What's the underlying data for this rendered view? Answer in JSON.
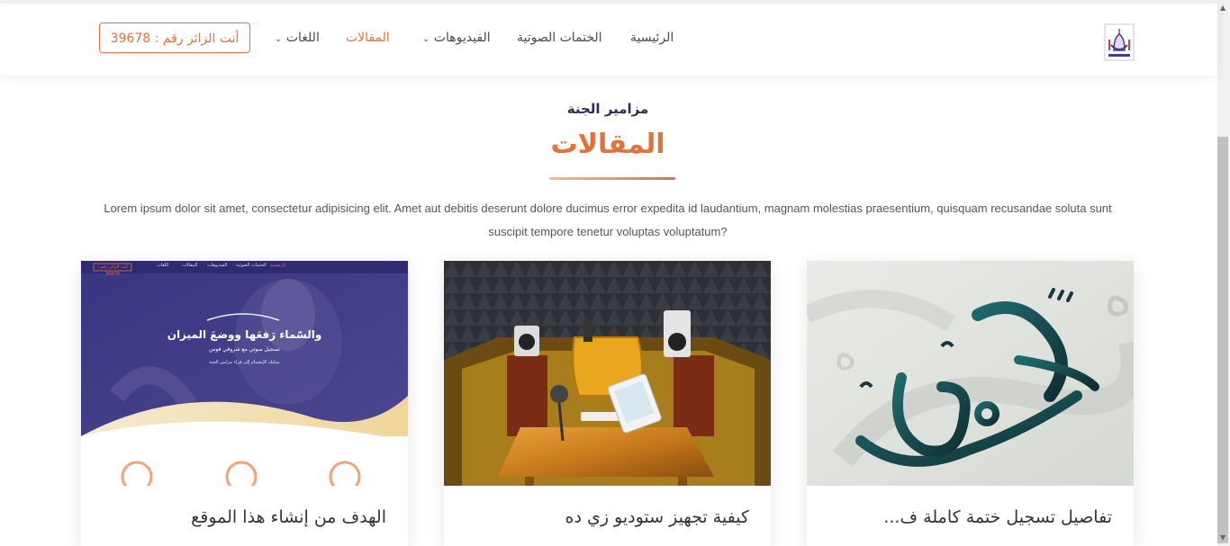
{
  "header": {
    "logo": "site-logo",
    "nav": [
      {
        "label": "الرئيسية",
        "active": false,
        "dropdown": false
      },
      {
        "label": "الختمات الصوتية",
        "active": false,
        "dropdown": false
      },
      {
        "label": "الفيديوهات",
        "active": false,
        "dropdown": true
      },
      {
        "label": "المقالات",
        "active": true,
        "dropdown": false
      },
      {
        "label": "اللغات",
        "active": false,
        "dropdown": true
      }
    ],
    "visitor_label": "أنت الزائر رقم : 39678"
  },
  "section": {
    "subtitle": "مزامير الجنة",
    "title": "المقالات",
    "description": "Lorem ipsum dolor sit amet, consectetur adipisicing elit. Amet aut debitis deserunt dolore ducimus error expedita id laudantium, magnam molestias praesentium, quisquam recusandae soluta sunt suscipit tempore tenetur voluptas voluptatum?"
  },
  "cards": [
    {
      "title": "تفاصيل تسجيل ختمة كاملة ف...",
      "image": "khatma-calligraphy"
    },
    {
      "title": "كيفية تجهيز ستوديو زي ده",
      "image": "recording-studio"
    },
    {
      "title": "الهدف من إنشاء هذا الموقع",
      "image": "website-screenshot",
      "thumb": {
        "verse": "والسّماء رَفعَها ووضعَ الميزان",
        "line1": "تسجيل صوتي مع شروقي فوس",
        "line2": "يمكنك الإنضمام إلى قراء مزامير الجنة",
        "nav": [
          "الرئيسية",
          "الختمات الصوتية",
          "الفيديوهات",
          "المقالات",
          "اللغات"
        ],
        "visitor": "أنت الزائر رقم : 39678"
      }
    }
  ],
  "colors": {
    "accent": "#e4703a",
    "heading": "#2b2f55",
    "purple": "#3f3b8e"
  }
}
